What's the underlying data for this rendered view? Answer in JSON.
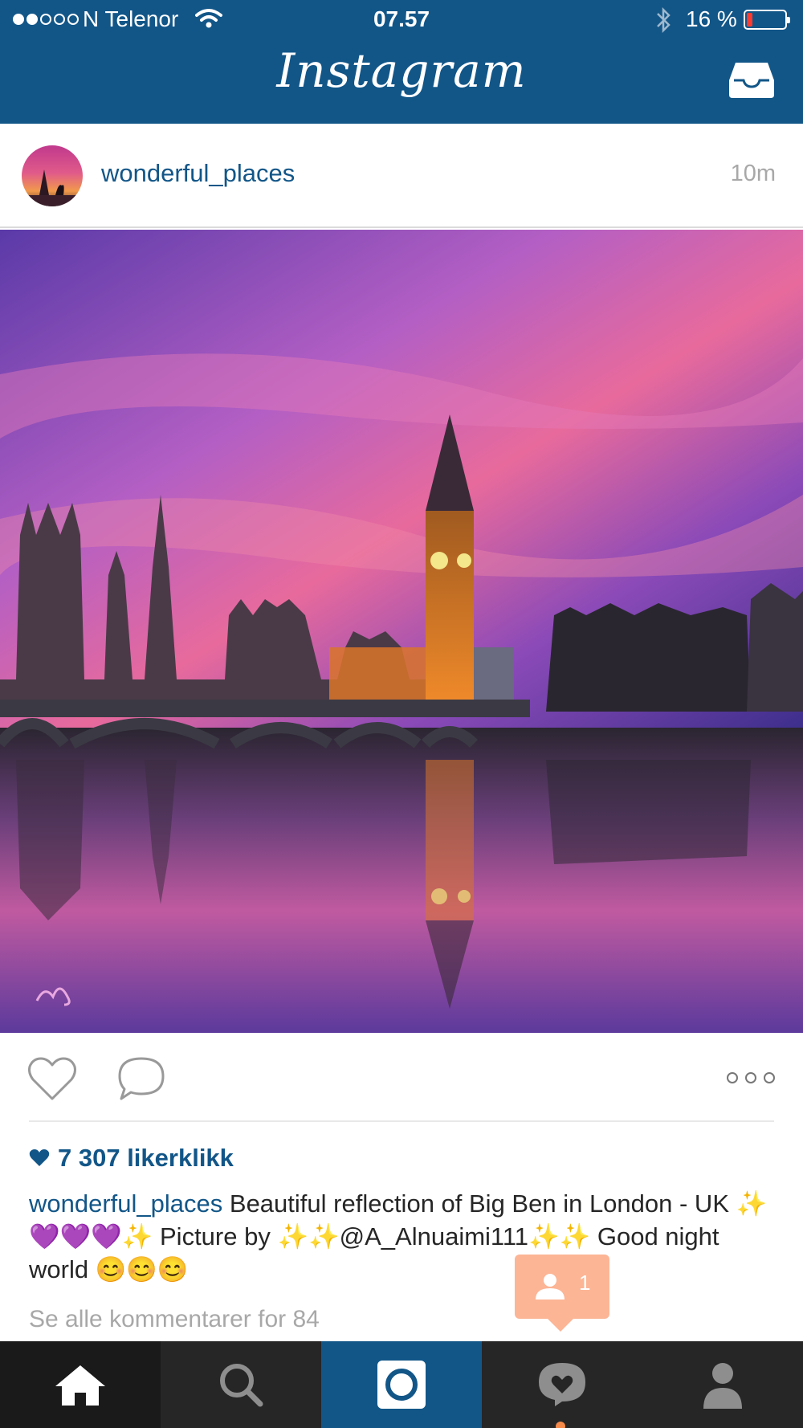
{
  "status_bar": {
    "carrier": "N Telenor",
    "time": "07.57",
    "battery_percent": "16 %",
    "battery_level": 0.16,
    "signal_bars_filled": 2,
    "signal_bars_total": 5
  },
  "nav": {
    "title": "Instagram",
    "inbox_icon": "inbox-tray-icon"
  },
  "post": {
    "username": "wonderful_places",
    "time_ago": "10m",
    "photo_watermark": "signature-watermark"
  },
  "actions": {
    "like_icon": "heart-outline-icon",
    "comment_icon": "comment-bubble-icon",
    "more_icon": "three-dots-icon"
  },
  "likes": {
    "text": "7 307 likerklikk"
  },
  "caption": {
    "username": "wonderful_places",
    "text": "Beautiful reflection of Big Ben in London - UK ✨💜💜💜✨ Picture by ✨✨@A_Alnuaimi111✨✨ Good night world 😊😊😊"
  },
  "comments": {
    "link": "Se alle kommentarer for 84"
  },
  "notification": {
    "count": "1",
    "icon": "person-icon"
  },
  "tabs": [
    {
      "id": "home",
      "icon": "home-icon"
    },
    {
      "id": "search",
      "icon": "search-icon"
    },
    {
      "id": "camera",
      "icon": "camera-icon"
    },
    {
      "id": "activity",
      "icon": "heart-bubble-icon"
    },
    {
      "id": "profile",
      "icon": "profile-icon"
    }
  ],
  "colors": {
    "brand_blue": "#125688",
    "tab_bar": "#262626",
    "notification": "#fca882",
    "battery_low": "#ff3b30"
  }
}
